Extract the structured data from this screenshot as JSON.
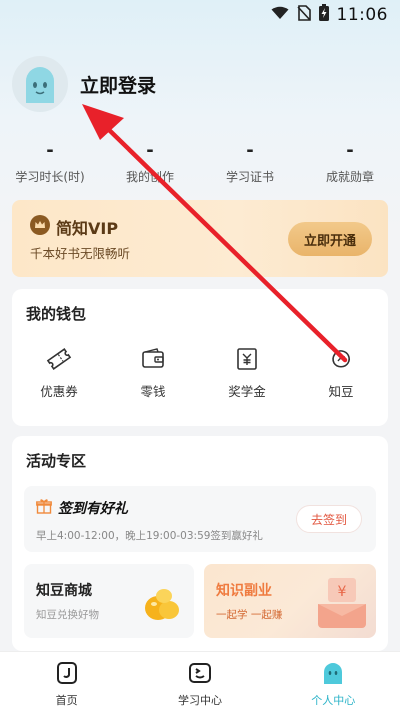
{
  "status_bar": {
    "time": "11:06"
  },
  "profile": {
    "login_text": "立即登录"
  },
  "stats": [
    {
      "value": "-",
      "label": "学习时长(时)"
    },
    {
      "value": "-",
      "label": "我的创作"
    },
    {
      "value": "-",
      "label": "学习证书"
    },
    {
      "value": "-",
      "label": "成就勋章"
    }
  ],
  "vip": {
    "title": "简知VIP",
    "subtitle": "千本好书无限畅听",
    "button_label": "立即开通"
  },
  "wallet": {
    "title": "我的钱包",
    "items": [
      {
        "label": "优惠券",
        "icon": "coupon-icon"
      },
      {
        "label": "零钱",
        "icon": "wallet-icon"
      },
      {
        "label": "奖学金",
        "icon": "scholarship-icon"
      },
      {
        "label": "知豆",
        "icon": "bean-icon"
      }
    ]
  },
  "activity": {
    "title": "活动专区",
    "signin": {
      "title": "签到有好礼",
      "desc": "早上4:00-12:00，晚上19:00-03:59签到赢好礼",
      "button_label": "去签到"
    },
    "shop": {
      "title": "知豆商城",
      "subtitle": "知豆兑换好物"
    },
    "side_job": {
      "title": "知识副业",
      "subtitle": "一起学 一起赚"
    }
  },
  "bottom_nav": [
    {
      "label": "首页",
      "icon": "home-icon",
      "active": false
    },
    {
      "label": "学习中心",
      "icon": "study-center-icon",
      "active": false
    },
    {
      "label": "个人中心",
      "icon": "profile-center-icon",
      "active": true
    }
  ],
  "colors": {
    "accent": "#2bb3c8",
    "arrow": "#e8212a",
    "vip_text": "#5b3a16",
    "signin_button": "#e2563f"
  }
}
